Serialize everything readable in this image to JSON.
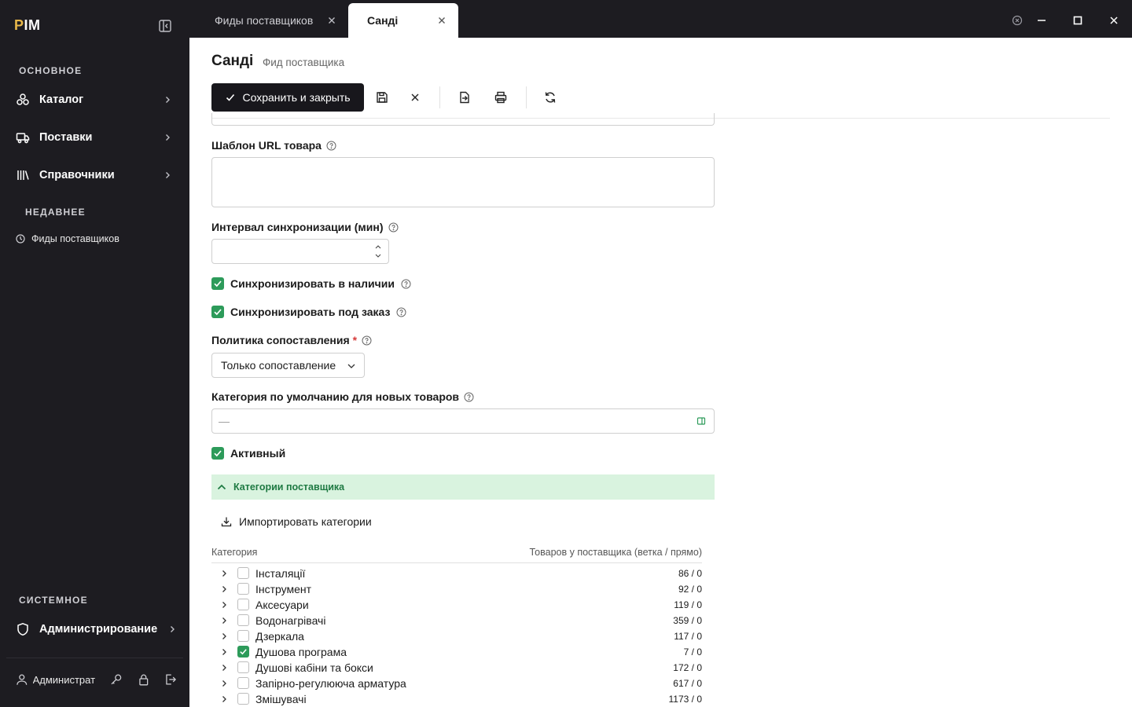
{
  "app": {
    "logo_prefix": "P",
    "logo_rest": "IM"
  },
  "sidebar": {
    "main_section": "ОСНОВНОЕ",
    "items": [
      {
        "label": "Каталог",
        "icon": "catalog-icon"
      },
      {
        "label": "Поставки",
        "icon": "truck-icon"
      },
      {
        "label": "Справочники",
        "icon": "library-icon"
      }
    ],
    "recent_section": "НЕДАВНЕЕ",
    "recent": [
      {
        "label": "Фиды поставщиков",
        "icon": "history-icon"
      }
    ],
    "system_section": "СИСТЕМНОЕ",
    "system_items": [
      {
        "label": "Администрирование",
        "icon": "shield-icon"
      }
    ],
    "user": {
      "name": "Администратор"
    }
  },
  "tabs": [
    {
      "label": "Фиды поставщиков",
      "active": false
    },
    {
      "label": "Санді",
      "active": true
    }
  ],
  "page": {
    "title": "Санді",
    "subtitle": "Фид поставщика",
    "save_close_label": "Сохранить и закрыть"
  },
  "form": {
    "url_template_label": "Шаблон URL товара",
    "url_template_value": "",
    "sync_interval_label": "Интервал синхронизации (мин)",
    "sync_interval_value": "",
    "sync_in_stock_label": "Синхронизировать в наличии",
    "sync_in_stock_checked": true,
    "sync_on_order_label": "Синхронизировать под заказ",
    "sync_on_order_checked": true,
    "matching_policy_label": "Политика сопоставления",
    "required_mark": "*",
    "matching_policy_value": "Только сопоставление",
    "default_category_label": "Категория по умолчанию для новых товаров",
    "default_category_value": "—",
    "active_label": "Активный",
    "active_checked": true
  },
  "categories_panel": {
    "title": "Категории поставщика",
    "import_label": "Импортировать категории",
    "col_category": "Категория",
    "col_count": "Товаров у поставщика (ветка / прямо)",
    "rows": [
      {
        "name": "Інсталяції",
        "count": "86 / 0",
        "checked": false
      },
      {
        "name": "Інструмент",
        "count": "92 / 0",
        "checked": false
      },
      {
        "name": "Аксесуари",
        "count": "119 / 0",
        "checked": false
      },
      {
        "name": "Водонагрівачі",
        "count": "359 / 0",
        "checked": false
      },
      {
        "name": "Дзеркала",
        "count": "117 / 0",
        "checked": false
      },
      {
        "name": "Душова програма",
        "count": "7 / 0",
        "checked": true
      },
      {
        "name": "Душові кабіни та бокси",
        "count": "172 / 0",
        "checked": false
      },
      {
        "name": "Запірно-регулююча арматура",
        "count": "617 / 0",
        "checked": false
      },
      {
        "name": "Змішувачі",
        "count": "1173 / 0",
        "checked": false
      }
    ]
  },
  "colors": {
    "accent_green": "#2d9b5a",
    "panel_green_bg": "#d9f3df",
    "sidebar_bg": "#1d1c21",
    "logo_yellow": "#e8b84a"
  }
}
